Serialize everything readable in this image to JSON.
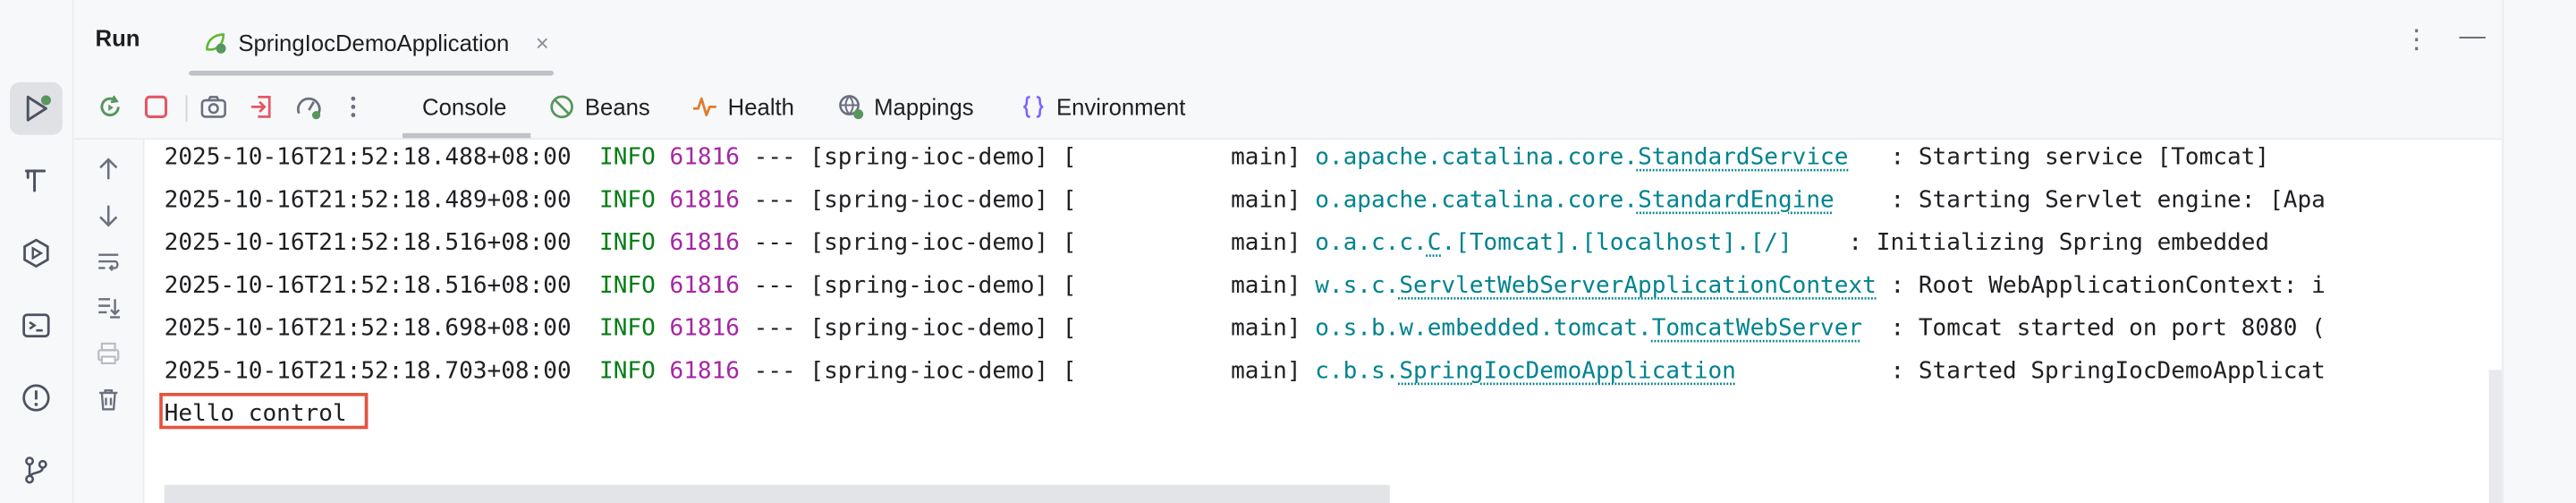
{
  "left_strip": {
    "items": [
      {
        "name": "run-icon",
        "active": true
      },
      {
        "name": "build-icon"
      },
      {
        "name": "services-icon"
      },
      {
        "name": "terminal-icon"
      },
      {
        "name": "problems-icon"
      },
      {
        "name": "git-icon"
      }
    ]
  },
  "header": {
    "title": "Run",
    "tab_label": "SpringIocDemoApplication",
    "tab_close": "×",
    "more_icon": "⋮",
    "minimize_icon": "—"
  },
  "toolbar": {
    "icons": [
      "rerun-icon",
      "stop-icon",
      "screenshot-icon",
      "exit-icon",
      "dashboard-icon",
      "more-icon"
    ],
    "tabs": [
      {
        "label": "Console",
        "icon": "none"
      },
      {
        "label": "Beans",
        "icon": "beans-icon"
      },
      {
        "label": "Health",
        "icon": "health-icon"
      },
      {
        "label": "Mappings",
        "icon": "mappings-icon"
      },
      {
        "label": "Environment",
        "icon": "environment-icon"
      }
    ]
  },
  "console": {
    "lines": [
      {
        "ts": "2025-10-16T21:52:18.488+08:00",
        "level": "INFO",
        "pid": "61816",
        "mid": " --- [spring-ioc-demo] [           main] ",
        "logger_prefix": "o.apache.catalina.core.",
        "logger_class": "StandardService",
        "pad": "   ",
        "message": ": Starting service [Tomcat]"
      },
      {
        "ts": "2025-10-16T21:52:18.489+08:00",
        "level": "INFO",
        "pid": "61816",
        "mid": " --- [spring-ioc-demo] [           main] ",
        "logger_prefix": "o.apache.catalina.core.",
        "logger_class": "StandardEngine",
        "pad": "    ",
        "message": ": Starting Servlet engine: [Apa"
      },
      {
        "ts": "2025-10-16T21:52:18.516+08:00",
        "level": "INFO",
        "pid": "61816",
        "mid": " --- [spring-ioc-demo] [           main] ",
        "logger_prefix": "o.a.c.c.",
        "logger_class": "C",
        "logger_suffix": ".[Tomcat].[localhost].[/]",
        "pad": "    ",
        "message": ": Initializing Spring embedded"
      },
      {
        "ts": "2025-10-16T21:52:18.516+08:00",
        "level": "INFO",
        "pid": "61816",
        "mid": " --- [spring-ioc-demo] [           main] ",
        "logger_prefix": "w.s.c.",
        "logger_class": "ServletWebServerApplicationContext",
        "pad": " ",
        "message": ": Root WebApplicationContext: i"
      },
      {
        "ts": "2025-10-16T21:52:18.698+08:00",
        "level": "INFO",
        "pid": "61816",
        "mid": " --- [spring-ioc-demo] [           main] ",
        "logger_prefix": "o.s.b.w.embedded.tomcat.",
        "logger_class": "TomcatWebServer",
        "pad": "  ",
        "message": ": Tomcat started on port 8080 ("
      },
      {
        "ts": "2025-10-16T21:52:18.703+08:00",
        "level": "INFO",
        "pid": "61816",
        "mid": " --- [spring-ioc-demo] [           main] ",
        "logger_prefix": "c.b.s.",
        "logger_class": "SpringIocDemoApplication",
        "pad": "           ",
        "message": ": Started SpringIocDemoApplicat"
      }
    ],
    "output": "Hello control"
  },
  "colors": {
    "accent_green": "#067d17",
    "pid_purple": "#a626a4",
    "logger_teal": "#00838f",
    "highlight_red": "#e5533d",
    "stop_red": "#e55765"
  }
}
